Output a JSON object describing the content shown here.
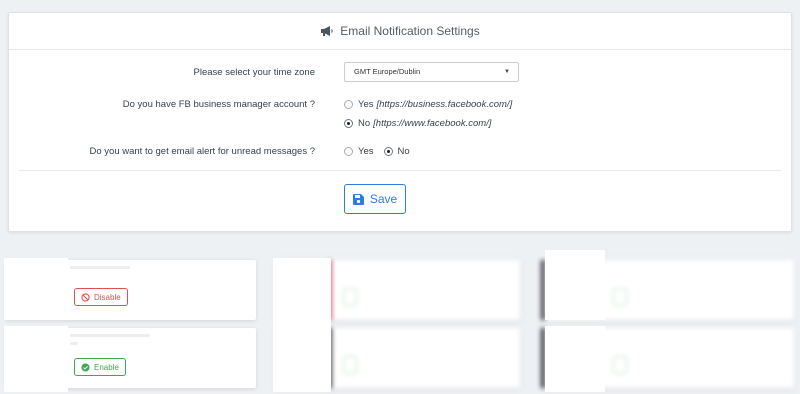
{
  "header": {
    "title": "Email Notification Settings",
    "icon": "megaphone-icon"
  },
  "form": {
    "timezone": {
      "label": "Please select your time zone",
      "value": "GMT Europe/Dublin"
    },
    "fb_account": {
      "label": "Do you have FB business manager account ?",
      "options": [
        {
          "label": "Yes",
          "hint": "[https://business.facebook.com/]",
          "checked": false
        },
        {
          "label": "No",
          "hint": "[https://www.facebook.com/]",
          "checked": true
        }
      ]
    },
    "email_alert": {
      "label": "Do you want to get email alert for unread messages ?",
      "options": [
        {
          "label": "Yes",
          "checked": false
        },
        {
          "label": "No",
          "checked": true
        }
      ]
    },
    "save_label": "Save"
  },
  "tiles": {
    "disable_label": "Disable",
    "enable_label": "Enable"
  },
  "colors": {
    "accent": "#2d7de0",
    "danger": "#d9534f",
    "success": "#3ea84f"
  }
}
